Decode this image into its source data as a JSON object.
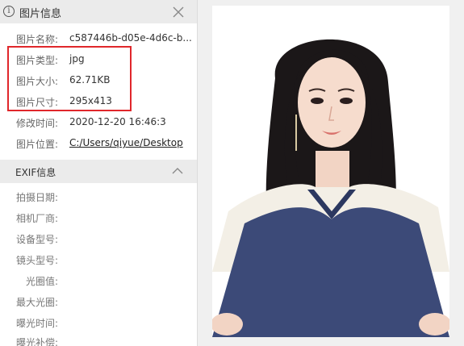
{
  "header": {
    "title": "图片信息"
  },
  "info": {
    "name_label": "图片名称:",
    "name_value": "c587446b-d05e-4d6c-b...",
    "type_label": "图片类型:",
    "type_value": "jpg",
    "size_label": "图片大小:",
    "size_value": "62.71KB",
    "dims_label": "图片尺寸:",
    "dims_value": "295x413",
    "modified_label": "修改时间:",
    "modified_value": "2020-12-20 16:46:3",
    "location_label": "图片位置:",
    "location_value": "C:/Users/qiyue/Desktop"
  },
  "exif": {
    "title": "EXIF信息",
    "labels": [
      "拍摄日期:",
      "相机厂商:",
      "设备型号:",
      "镜头型号:",
      "光圈值:",
      "最大光圈:",
      "曝光时间:",
      "曝光补偿:"
    ]
  },
  "colors": {
    "highlight": "#e0272b",
    "shirt": "#3c4a78",
    "collar": "#f3efe6"
  }
}
